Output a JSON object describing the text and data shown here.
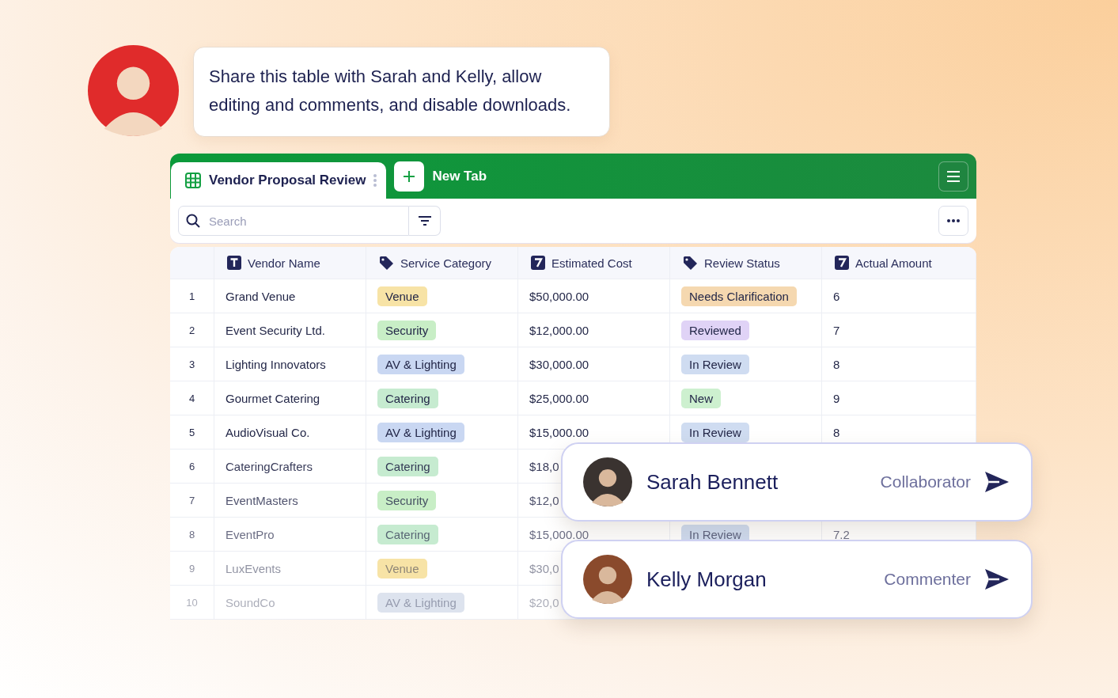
{
  "prompt": {
    "text": "Share this table with Sarah and Kelly, allow editing and comments, and disable downloads."
  },
  "sheet_tab": {
    "label": "Vendor Proposal Review",
    "selected": true
  },
  "new_tab": {
    "label": "New Tab"
  },
  "search": {
    "placeholder": "Search"
  },
  "table": {
    "columns": [
      {
        "label": "Vendor Name",
        "kind": "text"
      },
      {
        "label": "Service Category",
        "kind": "tag"
      },
      {
        "label": "Estimated Cost",
        "kind": "number"
      },
      {
        "label": "Review Status",
        "kind": "tag"
      },
      {
        "label": "Actual Amount",
        "kind": "number"
      }
    ],
    "rows": [
      {
        "index": "1",
        "vendor": "Grand Venue",
        "category": {
          "label": "Venue",
          "color": "#f7e3a6"
        },
        "cost": "$50,000.00",
        "status": {
          "label": "Needs Clarification",
          "color": "#f5d8b0"
        },
        "amount": "6"
      },
      {
        "index": "2",
        "vendor": "Event Security Ltd.",
        "category": {
          "label": "Security",
          "color": "#c8eec6"
        },
        "cost": "$12,000.00",
        "status": {
          "label": "Reviewed",
          "color": "#e0d3f6"
        },
        "amount": "7"
      },
      {
        "index": "3",
        "vendor": "Lighting Innovators",
        "category": {
          "label": "AV & Lighting",
          "color": "#c9d7f2"
        },
        "cost": "$30,000.00",
        "status": {
          "label": "In Review",
          "color": "#cfdcf1"
        },
        "amount": "8"
      },
      {
        "index": "4",
        "vendor": "Gourmet Catering",
        "category": {
          "label": "Catering",
          "color": "#c6ebd0"
        },
        "cost": "$25,000.00",
        "status": {
          "label": "New",
          "color": "#cdf0cf"
        },
        "amount": "9"
      },
      {
        "index": "5",
        "vendor": "AudioVisual Co.",
        "category": {
          "label": "AV & Lighting",
          "color": "#c9d7f2"
        },
        "cost": "$15,000.00",
        "status": {
          "label": "In Review",
          "color": "#cfdcf1"
        },
        "amount": "8"
      },
      {
        "index": "6",
        "vendor": "CateringCrafters",
        "category": {
          "label": "Catering",
          "color": "#c6ebd0"
        },
        "cost": "$18,0"
      },
      {
        "index": "7",
        "vendor": "EventMasters",
        "category": {
          "label": "Security",
          "color": "#c8eec6"
        },
        "cost": "$12,0"
      },
      {
        "index": "8",
        "vendor": "EventPro",
        "category": {
          "label": "Catering",
          "color": "#c6ebd0"
        },
        "cost": "$15,000.00",
        "status": {
          "label": "In Review",
          "color": "#cfdcf1"
        },
        "amount": "7.2"
      },
      {
        "index": "9",
        "vendor": "LuxEvents",
        "category": {
          "label": "Venue",
          "color": "#f7e3a6"
        },
        "cost": "$30,0"
      },
      {
        "index": "10",
        "vendor": "SoundCo",
        "category": {
          "label": "AV & Lighting",
          "color": "#dde3ee"
        },
        "cost": "$20,0"
      }
    ]
  },
  "share": [
    {
      "name": "Sarah Bennett",
      "role": "Collaborator"
    },
    {
      "name": "Kelly Morgan",
      "role": "Commenter"
    }
  ]
}
